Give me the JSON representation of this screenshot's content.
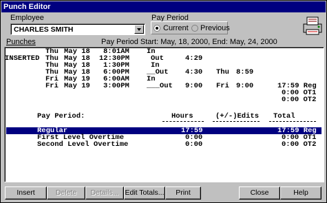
{
  "window": {
    "title": "Punch Editor"
  },
  "employee": {
    "label": "Employee",
    "selected": "CHARLES SMITH"
  },
  "pay_period": {
    "label": "Pay Period",
    "current": "Current",
    "previous": "Previous"
  },
  "punches_label": "Punches",
  "period_range": "Pay Period Start: May, 18, 2000,  End: May, 24, 2000",
  "punch_rows": [
    {
      "tag": "",
      "day": "Thu",
      "date": "May 18",
      "time": "8:01AM",
      "type": "In",
      "hours": "",
      "day2": "",
      "total": "",
      "extra": ""
    },
    {
      "tag": "INSERTED",
      "day": "Thu",
      "date": "May 18",
      "time": "12:30PM",
      "type": "Out",
      "hours": "4:29",
      "day2": "",
      "total": "",
      "extra": ""
    },
    {
      "tag": "",
      "day": "Thu",
      "date": "May 18",
      "time": "1:30PM",
      "type": "In",
      "hours": "",
      "day2": "",
      "total": "",
      "extra": ""
    },
    {
      "tag": "",
      "day": "Thu",
      "date": "May 18",
      "time": "6:00PM",
      "type": "__Out",
      "hours": "4:30",
      "day2": "Thu",
      "total": "8:59",
      "extra": ""
    },
    {
      "tag": "",
      "day": "Fri",
      "date": "May 19",
      "time": "6:00AM",
      "type": "In",
      "hours": "",
      "day2": "",
      "total": "",
      "extra": ""
    },
    {
      "tag": "",
      "day": "Fri",
      "date": "May 19",
      "time": "3:00PM",
      "type": "___Out",
      "hours": "9:00",
      "day2": "Fri",
      "total": "9:00",
      "extra": "17:59 Reg"
    }
  ],
  "extra_lines": [
    "0:00 OT1",
    "0:00 OT2"
  ],
  "summary": {
    "col_pay_period": "Pay Period:",
    "col_hours": "Hours",
    "col_edits": "(+/-)Edits",
    "col_total": "Total",
    "rows": [
      {
        "name": "Regular",
        "hours": "17:59",
        "total": "17:59 Reg"
      },
      {
        "name": "First Level Overtime",
        "hours": "0:00",
        "total": "0:00 OT1"
      },
      {
        "name": "Second Level Overtime",
        "hours": "0:00",
        "total": "0:00 OT2"
      }
    ]
  },
  "buttons": {
    "insert": "Insert",
    "delete": "Delete",
    "details": "Details...",
    "edit_totals": "Edit Totals...",
    "print": "Print",
    "close": "Close",
    "help": "Help"
  },
  "icons": {
    "print": "printer-icon",
    "dropdown": "chevron-down-icon"
  }
}
